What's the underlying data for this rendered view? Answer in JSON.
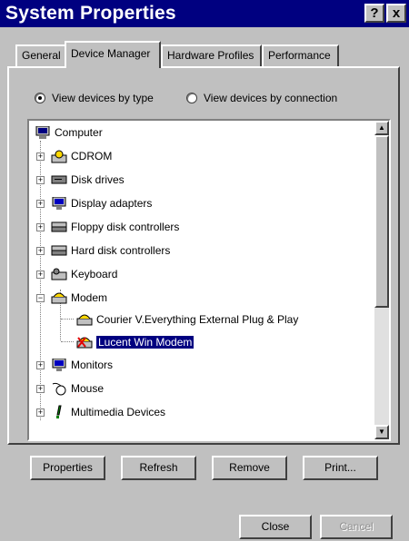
{
  "window": {
    "title": "System Properties",
    "help_glyph": "?",
    "close_glyph": "x"
  },
  "tabs": [
    {
      "label": "General",
      "active": false
    },
    {
      "label": "Device Manager",
      "active": true
    },
    {
      "label": "Hardware Profiles",
      "active": false
    },
    {
      "label": "Performance",
      "active": false
    }
  ],
  "view_options": {
    "by_type": {
      "label": "View devices by type",
      "selected": true
    },
    "by_connection": {
      "label": "View devices by connection",
      "selected": false
    }
  },
  "tree": {
    "root": {
      "label": "Computer",
      "icon": "computer-icon"
    },
    "items": [
      {
        "label": "CDROM",
        "icon": "cdrom-icon",
        "expander": "+"
      },
      {
        "label": "Disk drives",
        "icon": "disk-drive-icon",
        "expander": "+"
      },
      {
        "label": "Display adapters",
        "icon": "display-adapter-icon",
        "expander": "+"
      },
      {
        "label": "Floppy disk controllers",
        "icon": "floppy-controller-icon",
        "expander": "+"
      },
      {
        "label": "Hard disk controllers",
        "icon": "hard-disk-controller-icon",
        "expander": "+"
      },
      {
        "label": "Keyboard",
        "icon": "keyboard-icon",
        "expander": "+"
      },
      {
        "label": "Modem",
        "icon": "modem-icon",
        "expander": "−"
      },
      {
        "label": "Courier V.Everything External Plug & Play",
        "icon": "modem-icon",
        "child": true
      },
      {
        "label": "Lucent Win Modem",
        "icon": "modem-error-icon",
        "child": true,
        "selected": true
      },
      {
        "label": "Monitors",
        "icon": "monitor-icon",
        "expander": "+"
      },
      {
        "label": "Mouse",
        "icon": "mouse-icon",
        "expander": "+"
      },
      {
        "label": "Multimedia Devices",
        "icon": "multimedia-icon",
        "expander": "+"
      }
    ]
  },
  "buttons": {
    "properties": "Properties",
    "refresh": "Refresh",
    "remove": "Remove",
    "print": "Print...",
    "close": "Close",
    "cancel": "Cancel"
  },
  "scrollbar": {
    "up_glyph": "▲",
    "down_glyph": "▼"
  }
}
